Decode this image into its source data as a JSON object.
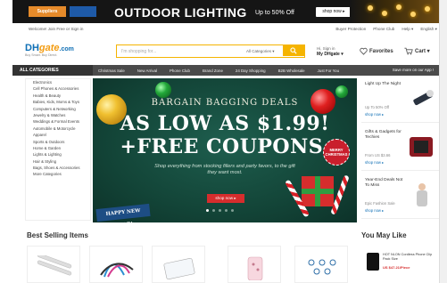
{
  "top_banner": {
    "supplier_label": "Suppliers",
    "title": "OUTDOOR LIGHTING",
    "discount": "Up to 50% Off",
    "shop_now": "shop now ▸"
  },
  "util": {
    "welcome": "Welcome! Join Free or Sign in",
    "links": [
      "Buyer Protection",
      "Phone Club",
      "Help ▾",
      "English ▾"
    ]
  },
  "header": {
    "logo_main": "DH",
    "logo_gate": "gate",
    "logo_suffix": ".com",
    "logo_tagline": "Buy Smart. Buy Direct.",
    "search_placeholder": "I'm shopping for...",
    "search_category": "All Categories ▾",
    "account_greeting": "Hi, Sign in",
    "account_label": "My DHgate ▾",
    "favorites_label": "Favorites",
    "cart_label": "Cart ▾",
    "cart_count": "0"
  },
  "category_bar": {
    "all_categories": "ALL CATEGORIES",
    "nav": [
      "Christmas Sale",
      "New Arrival",
      "Phone Club",
      "Brand Zone",
      "24 Day Shopping",
      "B2B Wholesale",
      "Just For You"
    ],
    "app_promo": "Save more on our App !"
  },
  "sidebar": {
    "items": [
      "Electronics",
      "Cell Phones & Accessories",
      "Health & Beauty",
      "Babies, Kids, Moms & Toys",
      "Computers & Networking",
      "Jewelry & Watches",
      "Weddings & Formal Events",
      "Automobile & Motorcycle",
      "Apparel",
      "Sports & Outdoors",
      "Home & Garden",
      "Lights & Lighting",
      "Hair & Styling",
      "Bags, Shoes & Accessories",
      "More Categories"
    ]
  },
  "hero": {
    "heading": "BARGAIN BAGGING DEALS",
    "price_line": "AS LOW AS $1.99!",
    "coupon_line": "+FREE COUPONS.",
    "sub": "Shop everything from stocking fillers and party favors, to the gift they want most.",
    "cta": "shop now ▸",
    "badge_new_year": "HAPPY NEW YEAR!",
    "badge_xmas": "MERRY CHRISTMAS"
  },
  "promos": [
    {
      "title": "Light Up The Night",
      "sub": "Up To 50% Off",
      "link": "shop now ▸"
    },
    {
      "title": "Gifts & Gadgets for Techies",
      "sub": "From US $3.66",
      "link": "shop now ▸"
    },
    {
      "title": "Year-End Deals Not To Miss",
      "sub": "Epic Fashion Sale",
      "link": "shop now ▸"
    }
  ],
  "bottom": {
    "best_selling": "Best Selling Items",
    "you_may_like": "You May Like",
    "may_title": "HOT NLON Cordless Phone Clip Pack Size",
    "may_price": "US $47.21/Piece"
  },
  "colors": {
    "accent": "#f5b400",
    "brand_blue": "#0f6fb5",
    "hero_green": "#134538",
    "cta_red": "#d62d2d"
  }
}
